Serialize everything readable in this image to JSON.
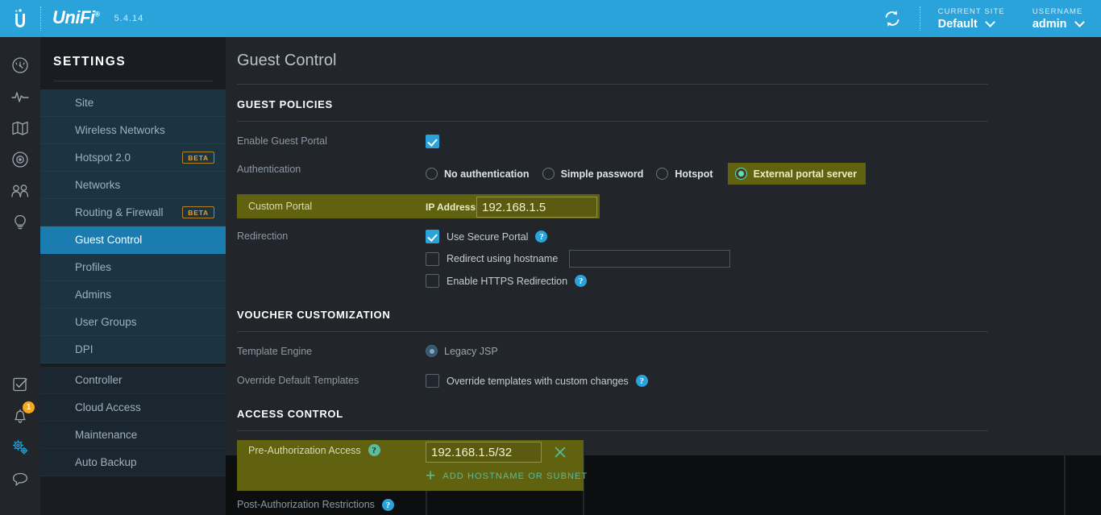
{
  "topbar": {
    "brand_icon": "ubiquiti-logo-icon",
    "wordmark": "UniFi",
    "trademark": "®",
    "version": "5.4.14",
    "refresh_icon": "refresh-icon",
    "current_site_label": "CURRENT SITE",
    "current_site_value": "Default",
    "username_label": "USERNAME",
    "username_value": "admin",
    "accent_color": "#2aa3da"
  },
  "rail": {
    "top_icons": [
      {
        "name": "dashboard-icon",
        "title": "Dashboard"
      },
      {
        "name": "statistics-icon",
        "title": "Statistics"
      },
      {
        "name": "map-icon",
        "title": "Map"
      },
      {
        "name": "devices-icon",
        "title": "Devices"
      },
      {
        "name": "clients-icon",
        "title": "Clients"
      },
      {
        "name": "insights-icon",
        "title": "Insights"
      }
    ],
    "bottom_icons": [
      {
        "name": "events-icon",
        "title": "Events",
        "badge": null
      },
      {
        "name": "alerts-bell-icon",
        "title": "Alerts",
        "badge": "1"
      },
      {
        "name": "settings-gears-icon",
        "title": "Settings",
        "badge": null
      },
      {
        "name": "chat-icon",
        "title": "Chat",
        "badge": null
      }
    ],
    "badge_color": "#f5a623"
  },
  "sidebar": {
    "title": "SETTINGS",
    "group1": [
      {
        "label": "Site",
        "badge": null,
        "active": false
      },
      {
        "label": "Wireless Networks",
        "badge": null,
        "active": false
      },
      {
        "label": "Hotspot 2.0",
        "badge": "BETA",
        "active": false
      },
      {
        "label": "Networks",
        "badge": null,
        "active": false
      },
      {
        "label": "Routing & Firewall",
        "badge": "BETA",
        "active": false
      },
      {
        "label": "Guest Control",
        "badge": null,
        "active": true
      },
      {
        "label": "Profiles",
        "badge": null,
        "active": false
      },
      {
        "label": "Admins",
        "badge": null,
        "active": false
      },
      {
        "label": "User Groups",
        "badge": null,
        "active": false
      },
      {
        "label": "DPI",
        "badge": null,
        "active": false
      }
    ],
    "group2": [
      {
        "label": "Controller",
        "badge": null,
        "active": false
      },
      {
        "label": "Cloud Access",
        "badge": null,
        "active": false
      },
      {
        "label": "Maintenance",
        "badge": null,
        "active": false
      },
      {
        "label": "Auto Backup",
        "badge": null,
        "active": false
      }
    ],
    "active_color": "#1b7cb0"
  },
  "page": {
    "title": "Guest Control"
  },
  "guest_policies": {
    "heading": "GUEST POLICIES",
    "enable_guest_portal": {
      "label": "Enable Guest Portal",
      "checked": true
    },
    "authentication": {
      "label": "Authentication",
      "options": [
        {
          "label": "No authentication",
          "selected": false
        },
        {
          "label": "Simple password",
          "selected": false
        },
        {
          "label": "Hotspot",
          "selected": false
        },
        {
          "label": "External portal server",
          "selected": true
        }
      ]
    },
    "custom_portal": {
      "label": "Custom Portal",
      "ip_label": "IP Address",
      "ip_value": "192.168.1.5",
      "highlighted": true
    },
    "redirection": {
      "label": "Redirection",
      "items": [
        {
          "label": "Use Secure Portal",
          "checked": true,
          "help": true,
          "input": null
        },
        {
          "label": "Redirect using hostname",
          "checked": false,
          "help": false,
          "input": ""
        },
        {
          "label": "Enable HTTPS Redirection",
          "checked": false,
          "help": true,
          "input": null
        }
      ]
    }
  },
  "voucher_customization": {
    "heading": "VOUCHER CUSTOMIZATION",
    "template_engine": {
      "label": "Template Engine",
      "option_label": "Legacy JSP",
      "selected": true
    },
    "override_default_templates": {
      "label": "Override Default Templates",
      "checkbox_label": "Override templates with custom changes",
      "checked": false,
      "help": true
    }
  },
  "access_control": {
    "heading": "ACCESS CONTROL",
    "pre_authorization": {
      "label": "Pre-Authorization Access",
      "help": true,
      "highlighted": true,
      "entries": [
        {
          "value": "192.168.1.5/32",
          "remove_icon": "close-x-icon"
        }
      ],
      "add_label": "ADD HOSTNAME OR SUBNET",
      "add_icon": "plus-icon"
    },
    "post_authorization": {
      "label": "Post-Authorization Restrictions",
      "help": true
    }
  },
  "colors": {
    "highlight_olive": "#60620f",
    "panel_bg": "#22262b",
    "sidebar_bg": "#191c21",
    "accent_blue": "#2aa3da",
    "teal": "#5bbb9e"
  }
}
